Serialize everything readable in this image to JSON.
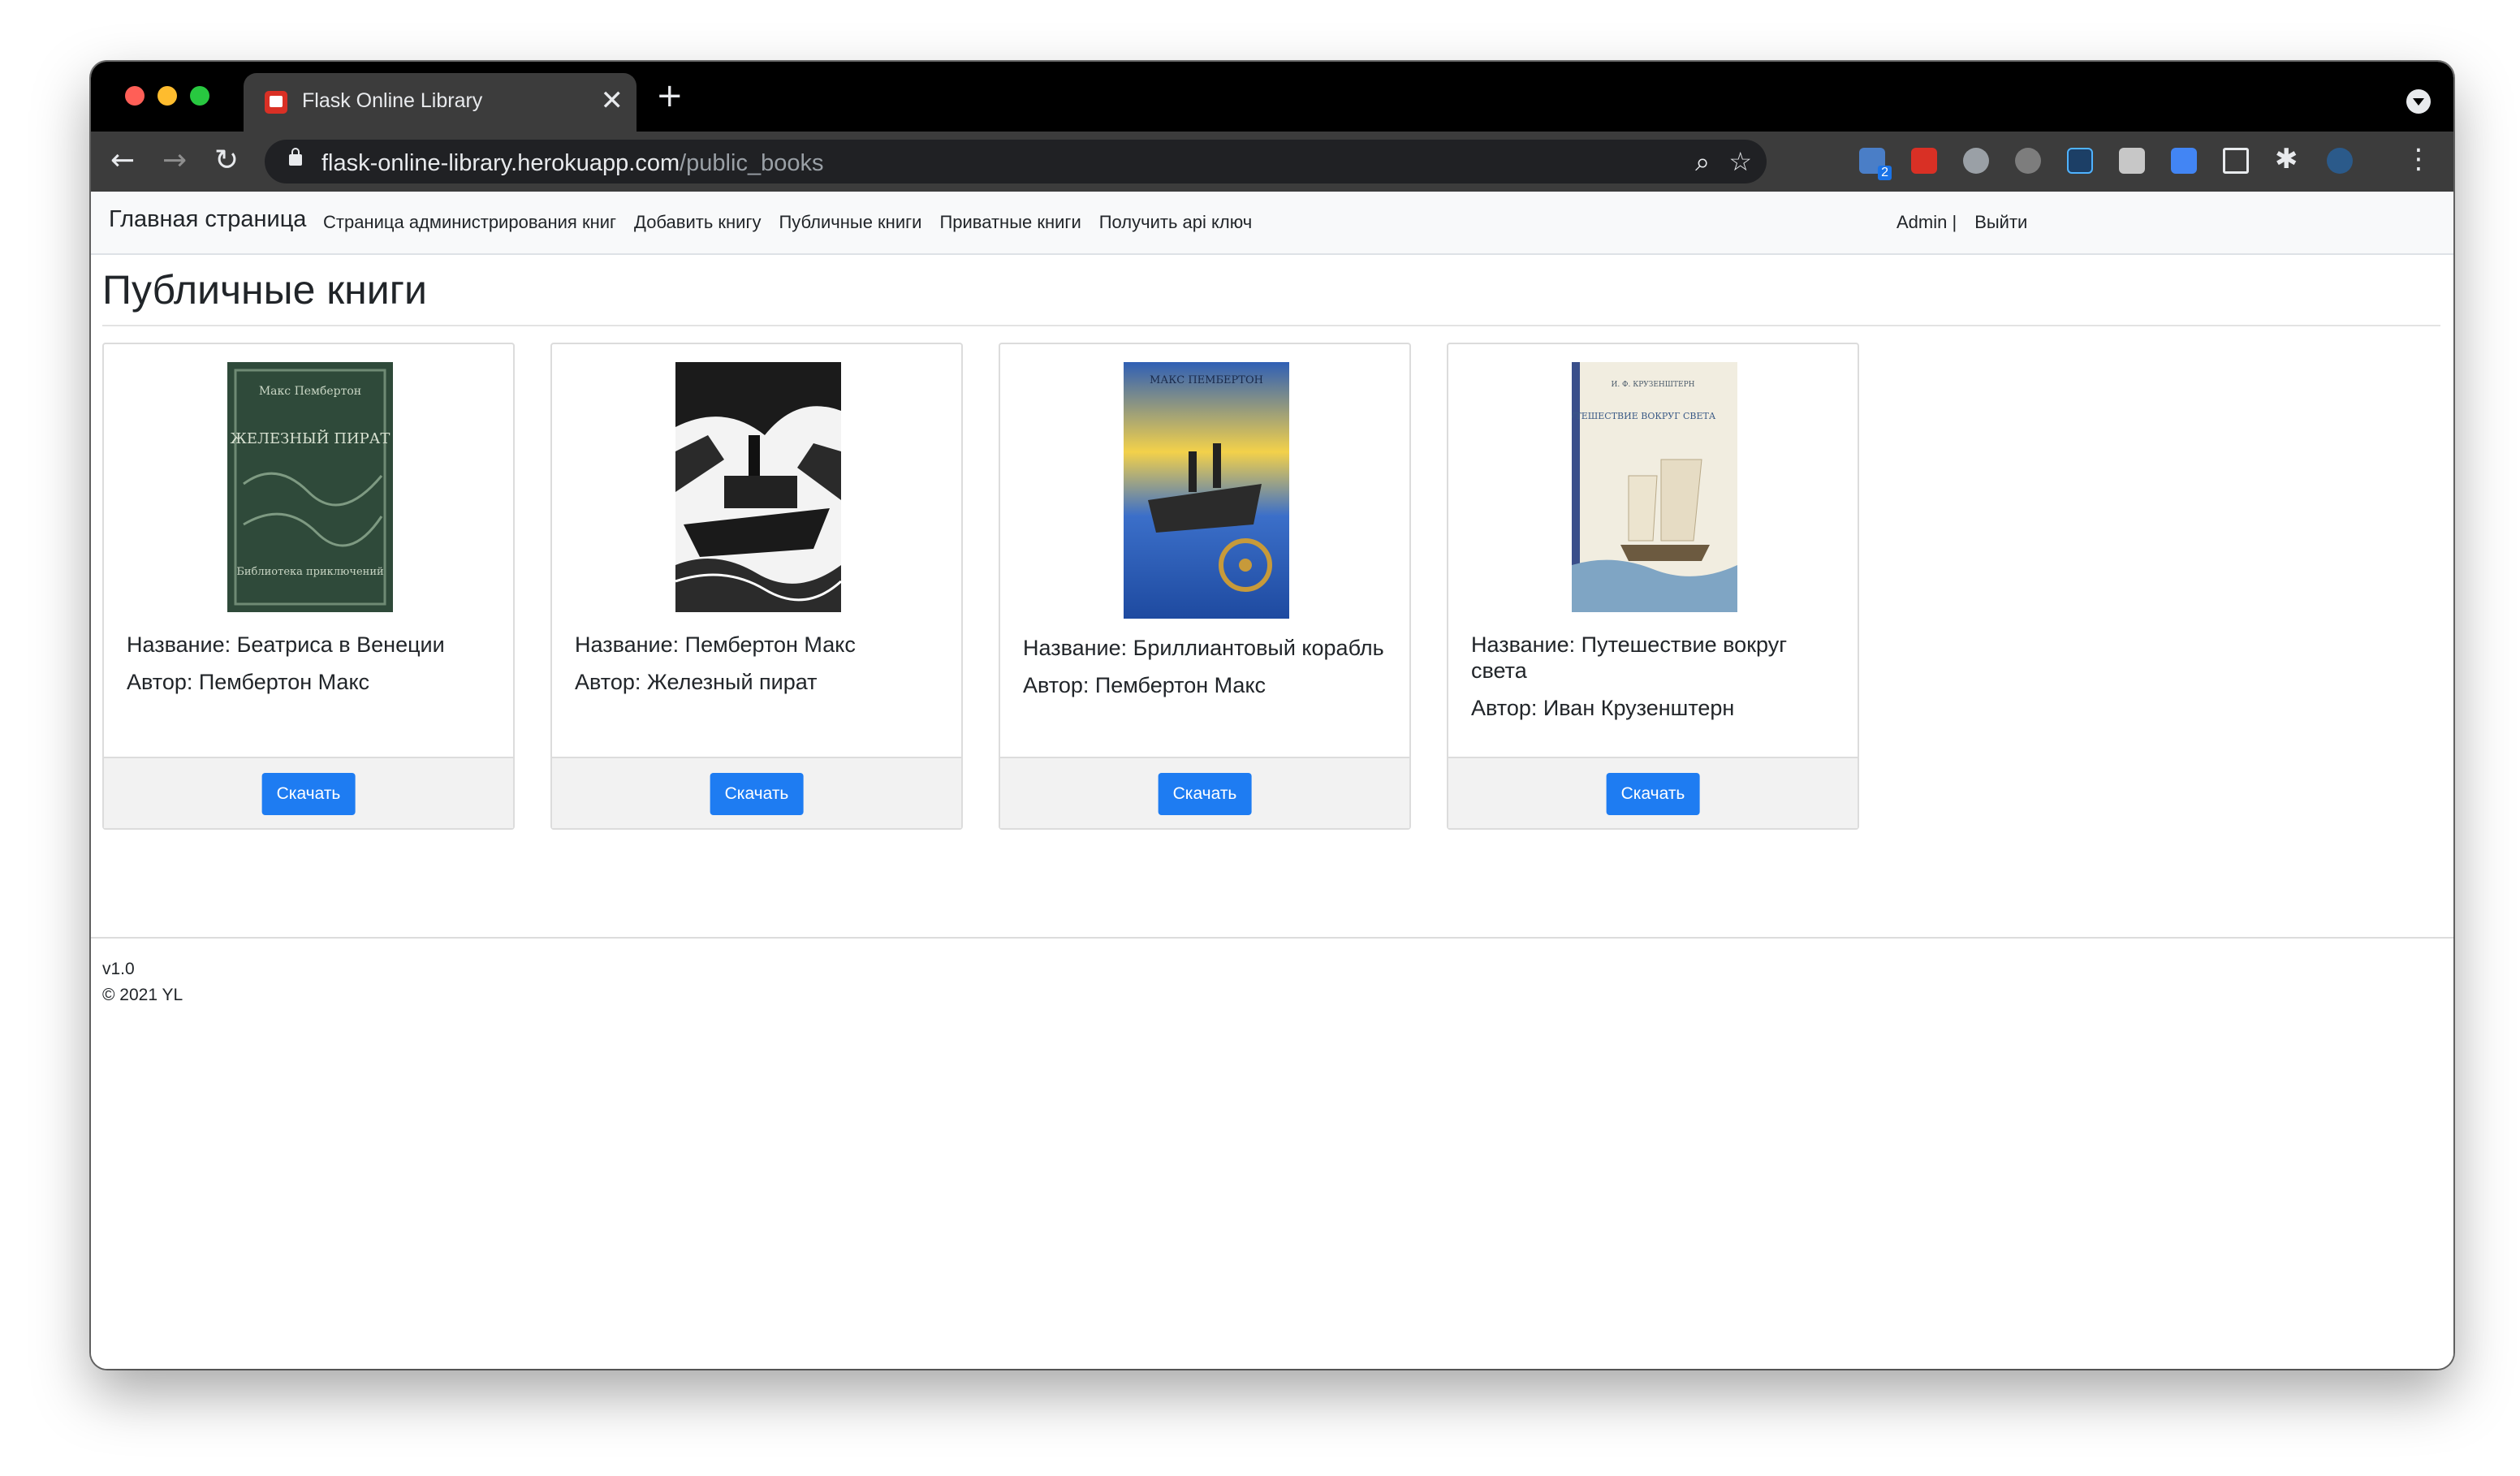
{
  "browser": {
    "tab_title": "Flask Online Library",
    "tab_close": "✕",
    "new_tab": "+",
    "url_host": "flask-online-library.herokuapp.com",
    "url_path": "/public_books",
    "mail_badge": "2",
    "icons": [
      "back-icon",
      "forward-icon",
      "reload-icon",
      "lock-icon",
      "search-icon",
      "star-icon",
      "puzzle-icon",
      "kebab-icon"
    ]
  },
  "navbar": {
    "brand": "Главная страница",
    "links": [
      "Страница администрирования книг",
      "Добавить книгу",
      "Публичные книги",
      "Приватные книги",
      "Получить api ключ"
    ],
    "user": "Admin |",
    "logout": "Выйти"
  },
  "page": {
    "title": "Публичные книги"
  },
  "books": [
    {
      "title": "Название: Беатриса в Венеции",
      "author": "Автор: Пембертон Макс",
      "button": "Скачать"
    },
    {
      "title": "Название: Пембертон Макс",
      "author": "Автор: Железный пират",
      "button": "Скачать"
    },
    {
      "title": "Название: Бриллиантовый корабль",
      "author": "Автор: Пембертон Макс",
      "button": "Скачать"
    },
    {
      "title": "Название: Путешествие вокруг света",
      "author": "Автор: Иван Крузенштерн",
      "button": "Скачать"
    }
  ],
  "covers": [
    {
      "top": "Макс Пембертон",
      "main": "ЖЕЛЕЗНЫЙ ПИРАТ",
      "bottom": "Библиотека приключений"
    },
    {
      "top": "",
      "main": "",
      "bottom": ""
    },
    {
      "top": "МАКС ПЕМБЕРТОН",
      "main": "",
      "bottom": ""
    },
    {
      "top": "И. Ф. КРУЗЕНШТЕРН",
      "main": "ПУТЕШЕСТВИЕ ВОКРУГ СВЕТА",
      "bottom": ""
    }
  ],
  "footer": {
    "version": "v1.0",
    "copyright": "© 2021 YL"
  },
  "colors": {
    "primary": "#1e7cf2",
    "navbar_bg": "#f8f9fa",
    "chrome_bg": "#3c3c3c"
  }
}
